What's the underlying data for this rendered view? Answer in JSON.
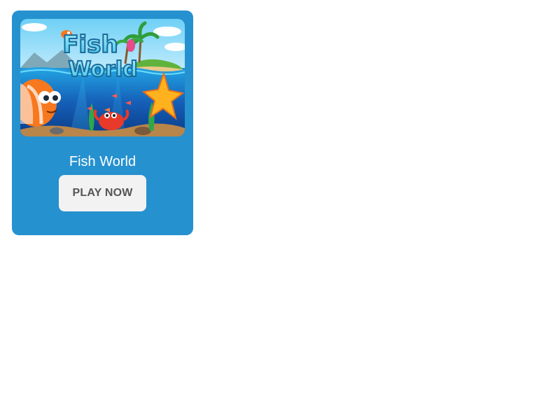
{
  "game_card": {
    "title": "Fish World",
    "play_label": "PLAY NOW",
    "thumbnail": {
      "logo_text_line1": "Fish",
      "logo_text_line2": "World",
      "scene": "underwater cartoon with orange fish, starfish, crab, island with palm trees"
    }
  },
  "colors": {
    "card_background": "#2691cf",
    "button_background": "#f2f2f2",
    "button_text": "#555555",
    "title_text": "#ffffff"
  }
}
